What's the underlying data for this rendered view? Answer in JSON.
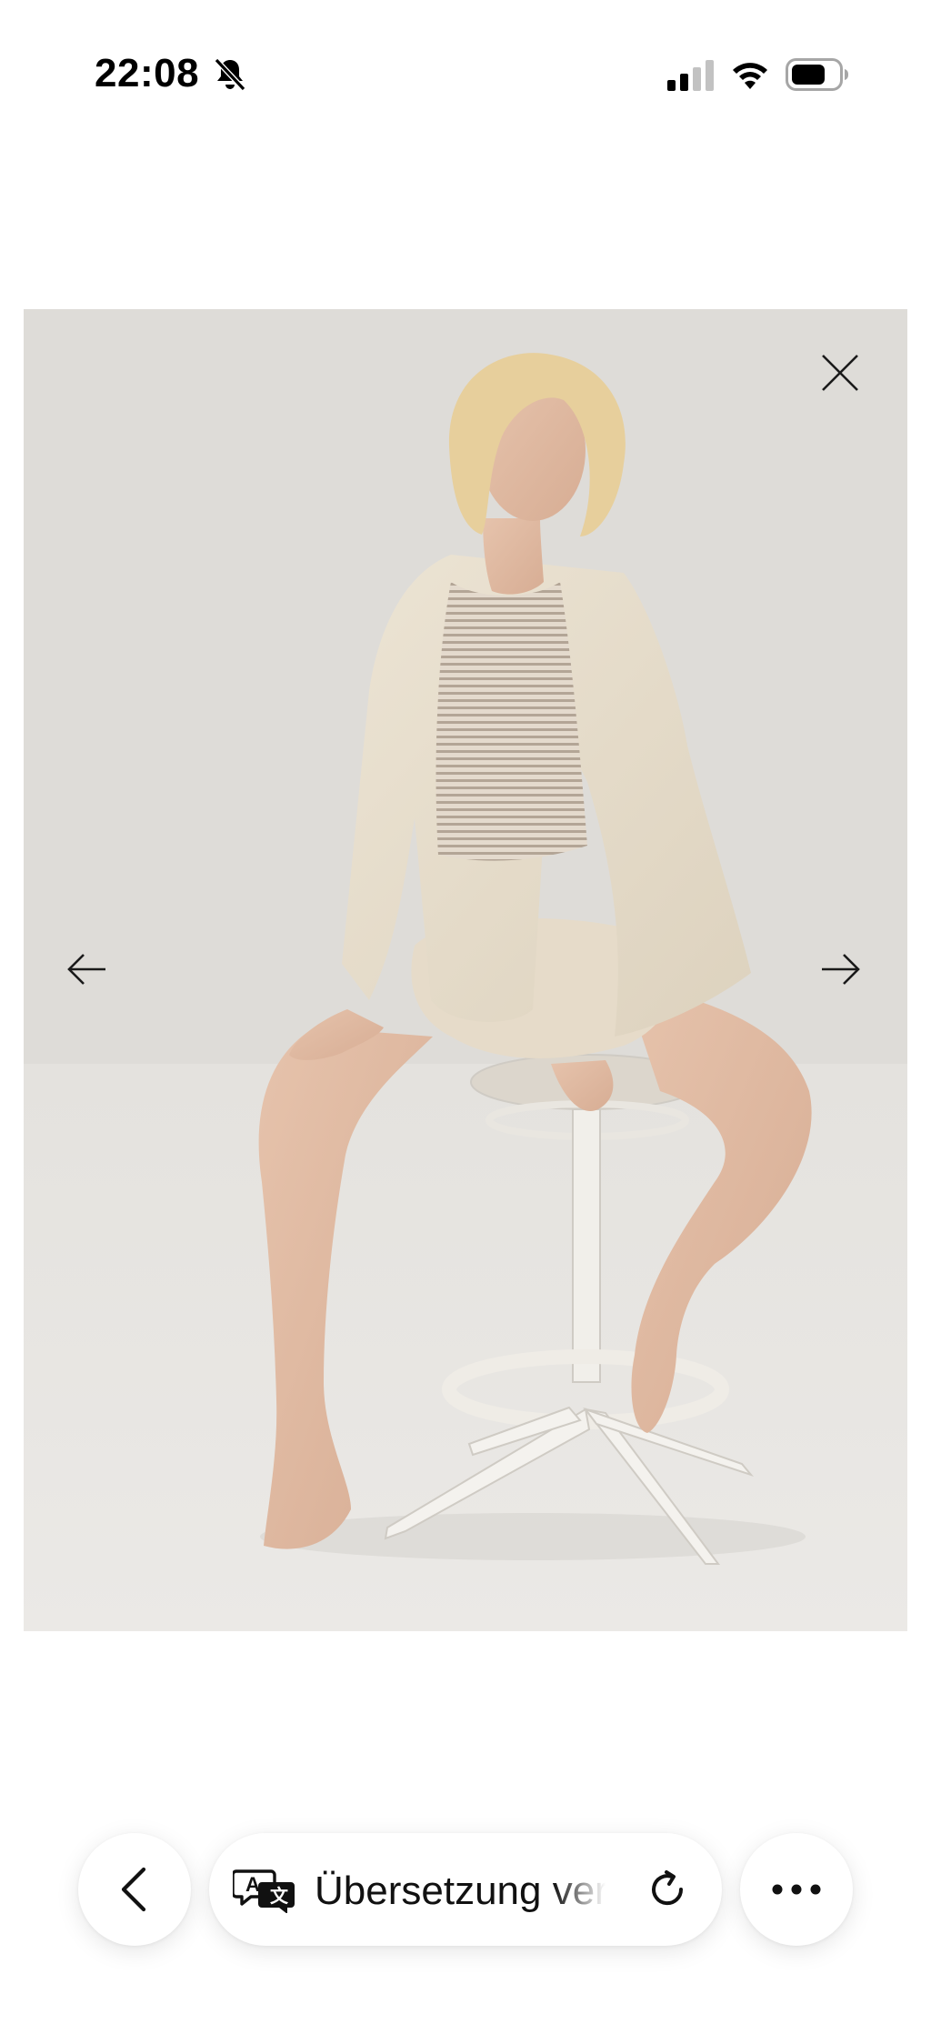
{
  "status_bar": {
    "time": "22:08",
    "icons": [
      "bell-slash-icon",
      "cellular-signal-icon",
      "wifi-icon",
      "battery-icon"
    ]
  },
  "viewer": {
    "image_alt": "",
    "controls": [
      "close-icon",
      "arrow-left-icon",
      "arrow-right-icon"
    ]
  },
  "toolbar": {
    "translate_label": "Übersetzung verfügbar",
    "icons": [
      "chevron-left-icon",
      "translate-icon",
      "reload-icon",
      "more-icon"
    ]
  },
  "colors": {
    "background": "#ffffff",
    "backdrop": "#dedcd8",
    "text": "#111111"
  }
}
